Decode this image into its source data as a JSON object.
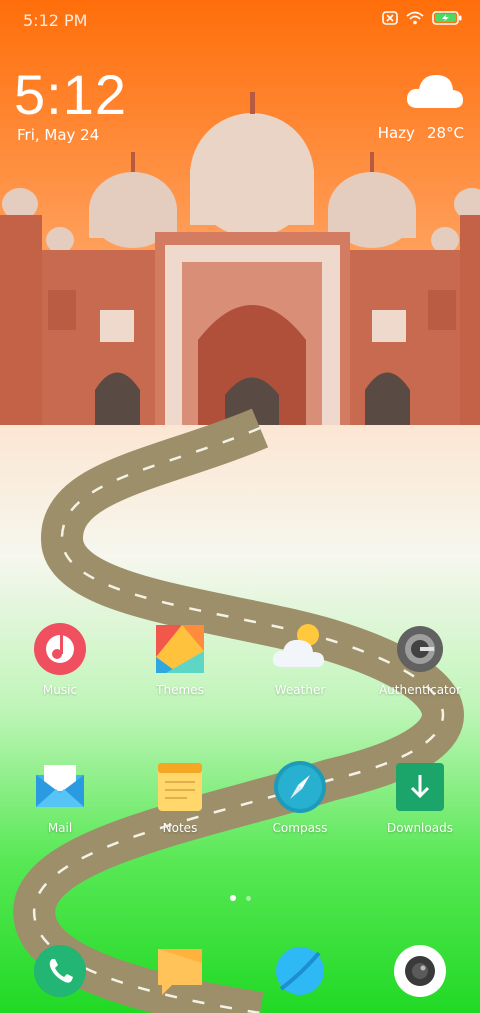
{
  "status_bar": {
    "time": "5:12 PM"
  },
  "clock_widget": {
    "time": "5:12",
    "date": "Fri, May 24"
  },
  "weather_widget": {
    "condition": "Hazy",
    "temperature": "28°C"
  },
  "apps_row1": [
    {
      "label": "Music",
      "icon": "music-icon"
    },
    {
      "label": "Themes",
      "icon": "themes-icon"
    },
    {
      "label": "Weather",
      "icon": "weather-icon"
    },
    {
      "label": "Authenticator",
      "icon": "authenticator-icon"
    }
  ],
  "apps_row2": [
    {
      "label": "Mail",
      "icon": "mail-icon"
    },
    {
      "label": "Notes",
      "icon": "notes-icon"
    },
    {
      "label": "Compass",
      "icon": "compass-icon"
    },
    {
      "label": "Downloads",
      "icon": "downloads-icon"
    }
  ],
  "dock": [
    {
      "icon": "phone-icon"
    },
    {
      "icon": "messaging-icon"
    },
    {
      "icon": "browser-icon"
    },
    {
      "icon": "camera-icon"
    }
  ],
  "page_indicator": {
    "pages": 2,
    "current": 1
  },
  "colors": {
    "sky_top": "#FF7A10",
    "sky_bottom": "#FDE8CC",
    "ground_green": "#39E23A",
    "building": "#C7664A",
    "road": "#9C8F6A"
  }
}
